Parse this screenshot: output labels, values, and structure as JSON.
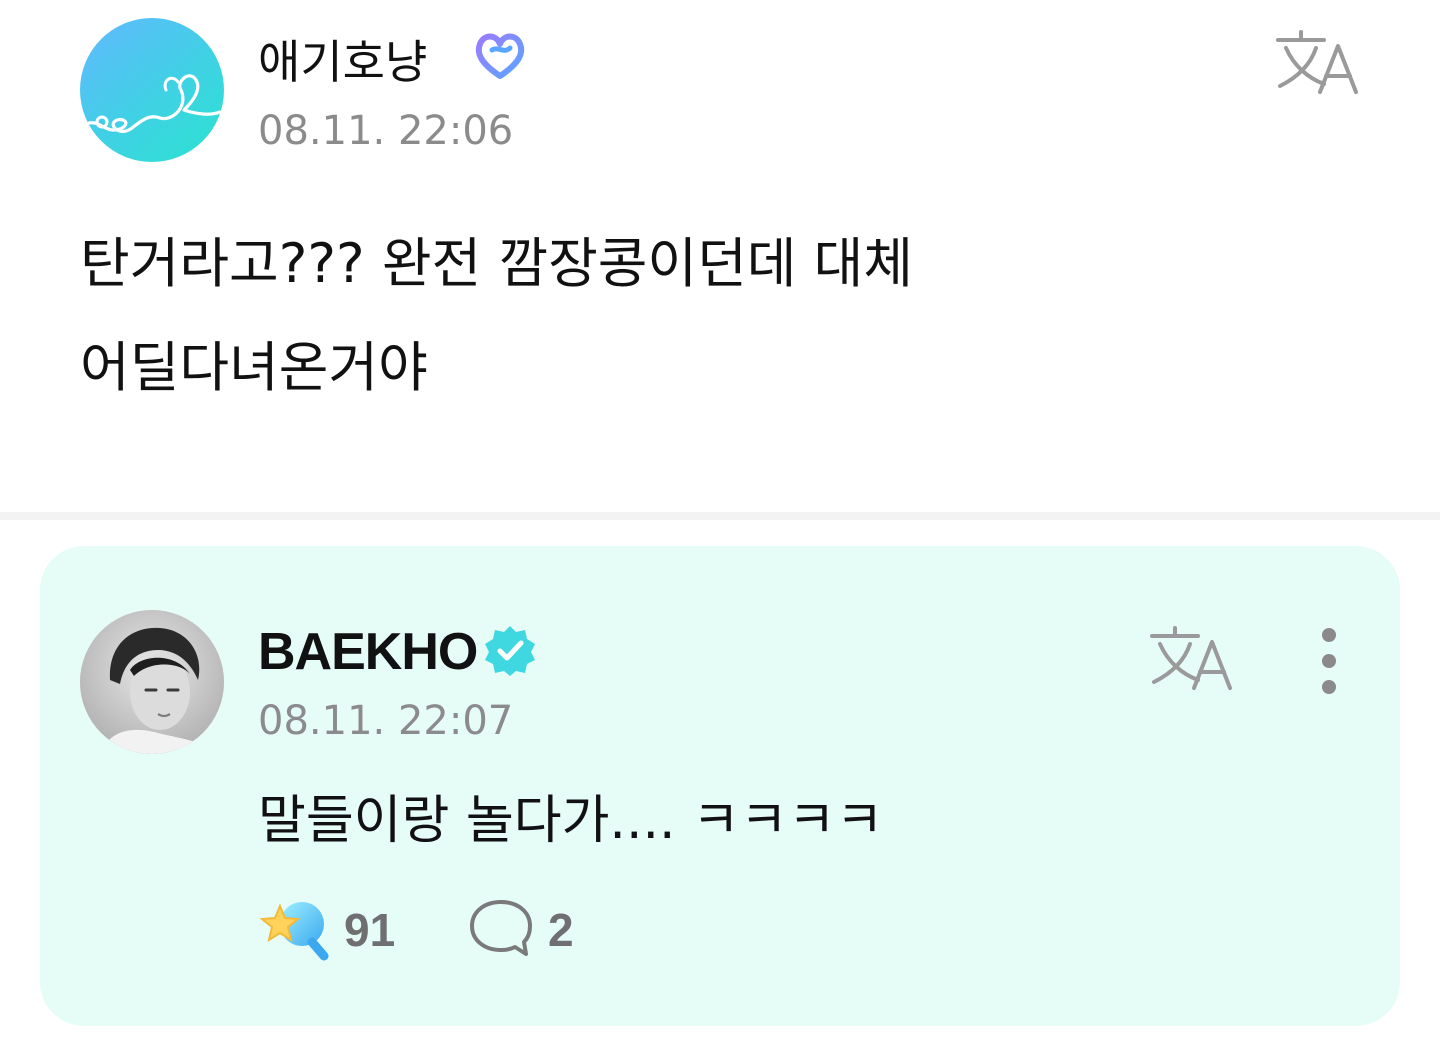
{
  "post": {
    "author": "애기호냥",
    "timestamp": "08.11. 22:06",
    "text_lines": [
      "탄거라고??? 완전 깜장콩이던데 대체",
      "어딜다녀온거야"
    ],
    "avatar_icon": "heart-doodle-icon",
    "badge_icon": "purple-heart-badge-icon",
    "translate_icon": "translate-icon"
  },
  "reply": {
    "author": "BAEKHO",
    "timestamp": "08.11. 22:07",
    "text": "말들이랑 놀다가.... ㅋㅋㅋㅋ",
    "verified_icon": "verified-check-icon",
    "translate_icon": "translate-icon",
    "more_icon": "more-vertical-icon",
    "likes": "91",
    "comments": "2",
    "like_icon": "star-wand-icon",
    "comment_icon": "comment-bubble-icon"
  },
  "colors": {
    "reply_bg": "#e6fcf7",
    "accent": "#3fd8e0",
    "muted_text": "#8b8b8b",
    "badge_purple": "#7b5cff"
  }
}
